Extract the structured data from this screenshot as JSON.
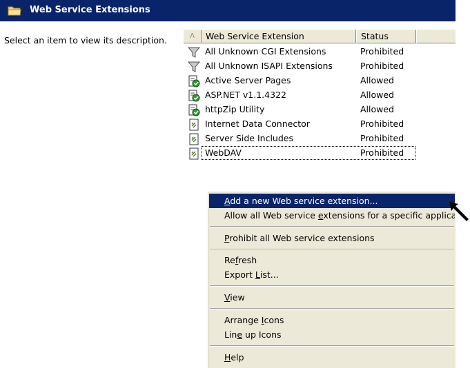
{
  "header": {
    "title": "Web Service Extensions",
    "icon": "folder-icon"
  },
  "description": "Select an item to view its description.",
  "list": {
    "columns": {
      "name": "Web Service Extension",
      "status": "Status",
      "sort_indicator": "Λ"
    },
    "rows": [
      {
        "name": "All Unknown CGI Extensions",
        "status": "Prohibited",
        "icon": "filter-icon"
      },
      {
        "name": "All Unknown ISAPI Extensions",
        "status": "Prohibited",
        "icon": "filter-icon"
      },
      {
        "name": "Active Server Pages",
        "status": "Allowed",
        "icon": "allowed-extension-icon"
      },
      {
        "name": "ASP.NET v1.1.4322",
        "status": "Allowed",
        "icon": "allowed-extension-icon"
      },
      {
        "name": "httpZip Utility",
        "status": "Allowed",
        "icon": "allowed-extension-icon"
      },
      {
        "name": "Internet Data Connector",
        "status": "Prohibited",
        "icon": "extension-icon"
      },
      {
        "name": "Server Side Includes",
        "status": "Prohibited",
        "icon": "extension-icon"
      },
      {
        "name": "WebDAV",
        "status": "Prohibited",
        "icon": "extension-icon"
      }
    ]
  },
  "menu": {
    "items": [
      {
        "pre": "",
        "u": "A",
        "post": "dd a new Web service extension..."
      },
      {
        "pre": "Allow all Web service ",
        "u": "e",
        "post": "xtensions for a specific applicatio"
      },
      {
        "pre": "",
        "u": "P",
        "post": "rohibit all Web service extensions"
      },
      {
        "pre": "Re",
        "u": "f",
        "post": "resh"
      },
      {
        "pre": "Export ",
        "u": "L",
        "post": "ist..."
      },
      {
        "pre": "",
        "u": "V",
        "post": "iew"
      },
      {
        "pre": "Arrange ",
        "u": "I",
        "post": "cons"
      },
      {
        "pre": "Lin",
        "u": "e",
        "post": " up Icons"
      },
      {
        "pre": "",
        "u": "H",
        "post": "elp"
      }
    ]
  },
  "colors": {
    "titlebar": "#0a246a",
    "menu_bg": "#ece9d8",
    "highlight": "#0a246a"
  }
}
